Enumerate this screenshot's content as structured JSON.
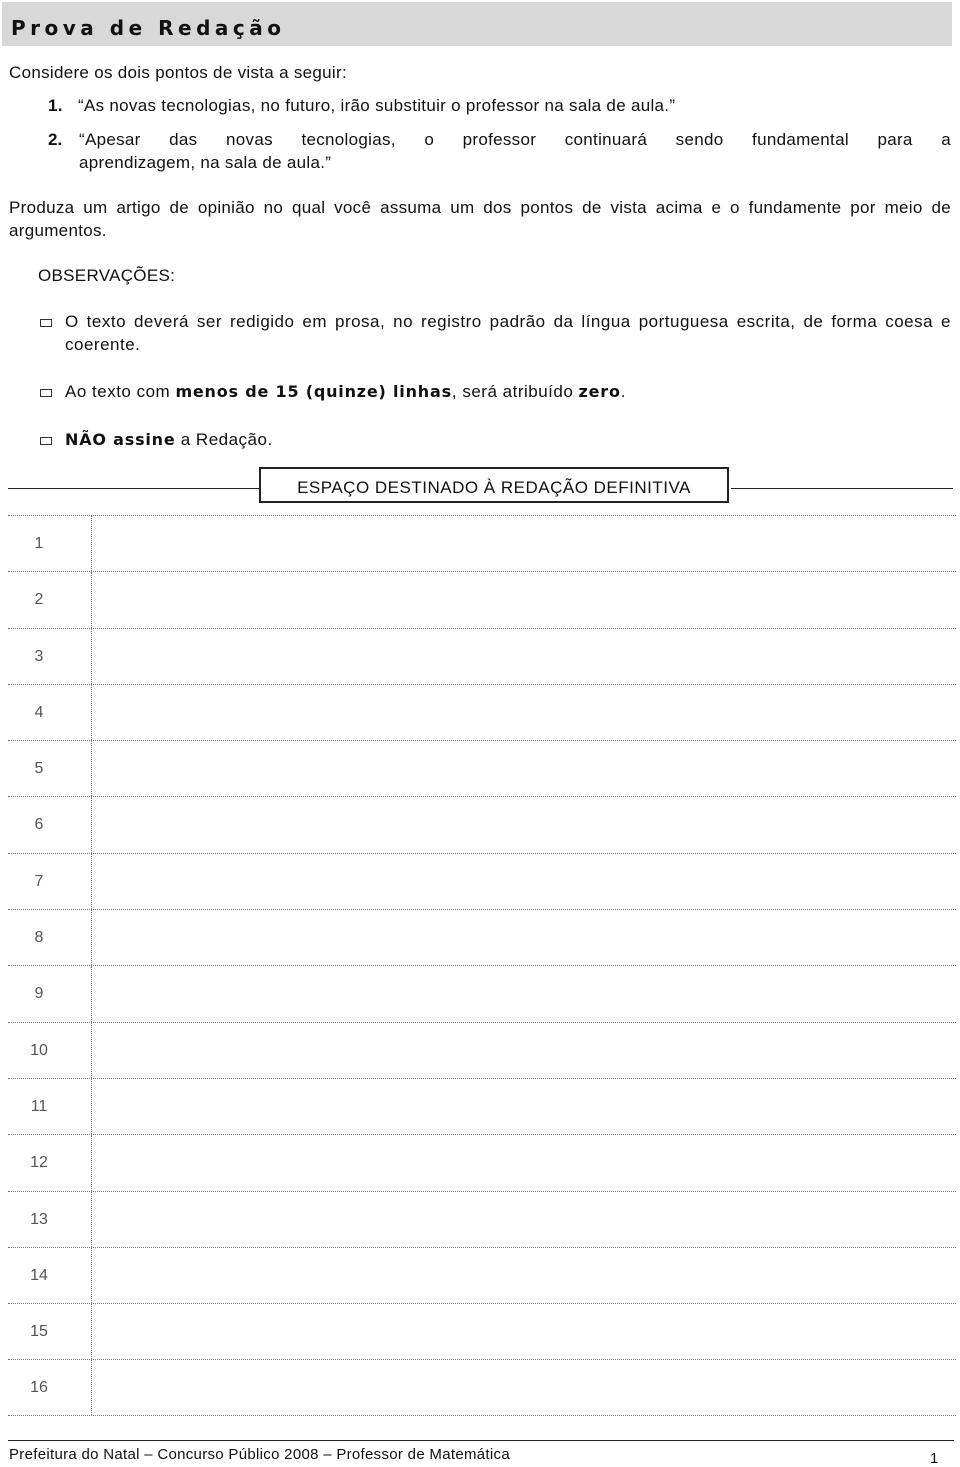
{
  "header": {
    "title": "Prova de Redação"
  },
  "intro": "Considere os dois pontos de vista a seguir:",
  "viewpoints": [
    {
      "num": "1.",
      "text": "“As novas tecnologias, no futuro, irão substituir o professor na sala de aula.”"
    },
    {
      "num": "2.",
      "line1": "“Apesar das novas tecnologias, o professor continuará sendo fundamental para a",
      "line2": "aprendizagem, na sala de aula.”"
    }
  ],
  "prompt": "Produza um artigo de opinião no qual você assuma um dos pontos de vista acima e o fundamente por meio de argumentos.",
  "observations": {
    "heading": "OBSERVAÇÕES:",
    "items": [
      {
        "text": "O texto deverá ser redigido em prosa, no registro padrão da língua portuguesa escrita, de forma coesa e coerente."
      },
      {
        "pre": "Ao texto com ",
        "bold": "menos de 15 (quinze) linhas",
        "mid": ", será atribuído ",
        "bold2": "zero",
        "post": "."
      },
      {
        "bold": "NÃO assine",
        "post": " a Redação."
      }
    ]
  },
  "section_label": "ESPAÇO DESTINADO À REDAÇÃO DEFINITIVA",
  "answer_lines": [
    "1",
    "2",
    "3",
    "4",
    "5",
    "6",
    "7",
    "8",
    "9",
    "10",
    "11",
    "12",
    "13",
    "14",
    "15",
    "16"
  ],
  "footer": {
    "text": "Prefeitura do Natal – Concurso Público 2008 – Professor de Matemática",
    "page": "1"
  }
}
